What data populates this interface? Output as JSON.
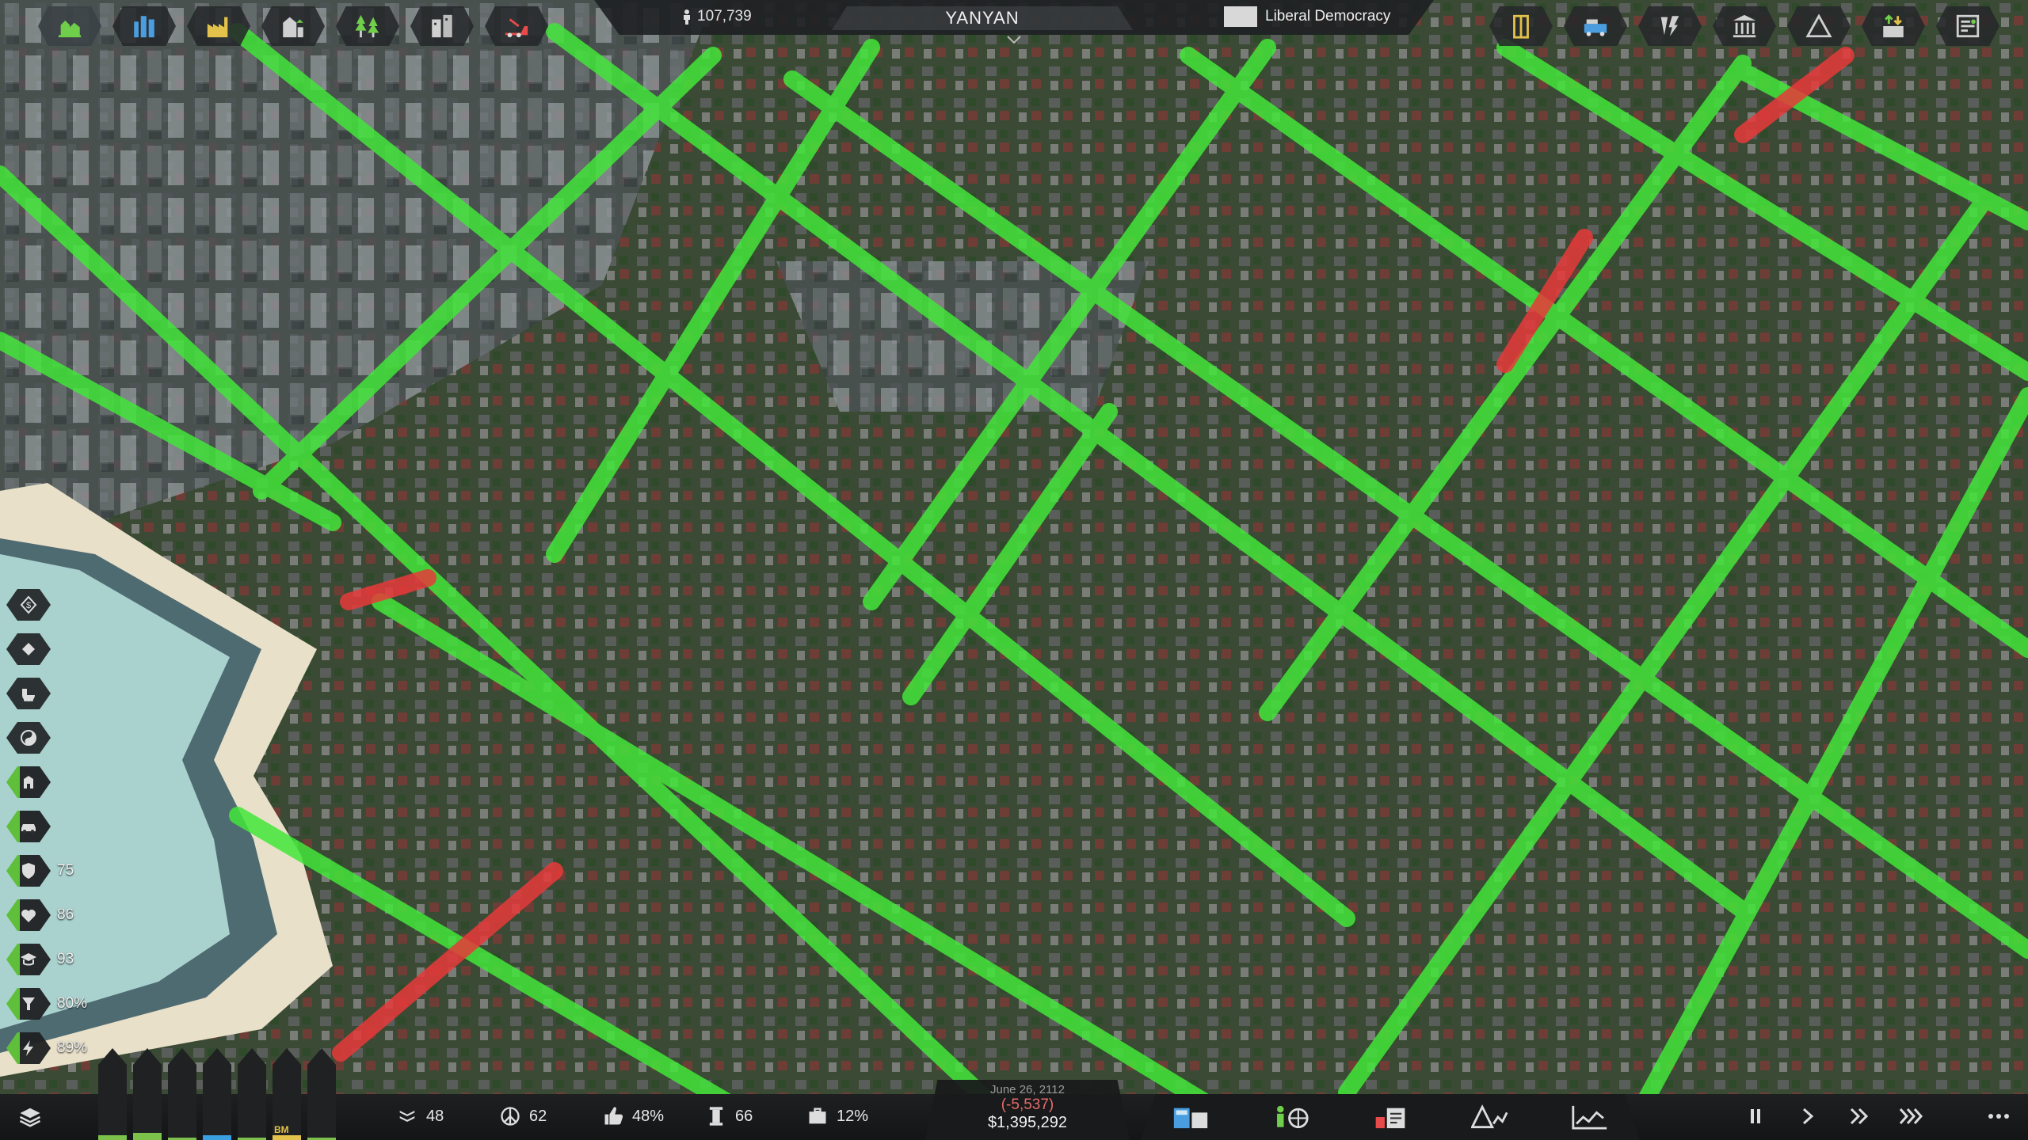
{
  "topbar": {
    "population": "107,739",
    "city_name": "YANYAN",
    "government": "Liberal Democracy",
    "left_buttons": [
      "residential-icon",
      "commercial-icon",
      "industrial-icon",
      "government-icon",
      "parks-icon",
      "buildings-icon",
      "construction-icon"
    ],
    "right_buttons": [
      "door-icon",
      "transport-icon",
      "power-icon",
      "ministry-icon",
      "terrain-icon",
      "import-export-icon",
      "budget-icon"
    ]
  },
  "side_panel": {
    "items": [
      {
        "icon": "money-icon",
        "value": ""
      },
      {
        "icon": "diamond-icon",
        "value": ""
      },
      {
        "icon": "stroller-icon",
        "value": ""
      },
      {
        "icon": "yinyang-icon",
        "value": ""
      },
      {
        "icon": "manager-icon",
        "value": ""
      },
      {
        "icon": "car-icon",
        "value": ""
      },
      {
        "icon": "shield-icon",
        "value": "75"
      },
      {
        "icon": "health-icon",
        "value": "86"
      },
      {
        "icon": "education-icon",
        "value": "93"
      },
      {
        "icon": "water-icon",
        "value": "80%"
      },
      {
        "icon": "electricity-icon",
        "value": "89%"
      }
    ]
  },
  "bottombar": {
    "bars_label": "BM",
    "bars": [
      {
        "fill": 0.05,
        "color": "#7cc24a"
      },
      {
        "fill": 0.08,
        "color": "#7cc24a"
      },
      {
        "fill": 0.03,
        "color": "#7cc24a"
      },
      {
        "fill": 0.05,
        "color": "#3aa0e0"
      },
      {
        "fill": 0.03,
        "color": "#7cc24a"
      },
      {
        "fill": 0.05,
        "color": "#e2c24a"
      },
      {
        "fill": 0.03,
        "color": "#7cc24a"
      }
    ],
    "stats": {
      "immigration": "48",
      "peace": "62",
      "approval": "48%",
      "pillar": "66",
      "unemployment": "12%"
    },
    "money": {
      "date": "June 26, 2112",
      "delta": "(-5,537)",
      "total": "$1,395,292"
    }
  },
  "colors": {
    "road_green": "#43e63a",
    "road_red": "#e83a3a",
    "panel": "#1e2022",
    "accent_green": "#5fbf3a"
  }
}
